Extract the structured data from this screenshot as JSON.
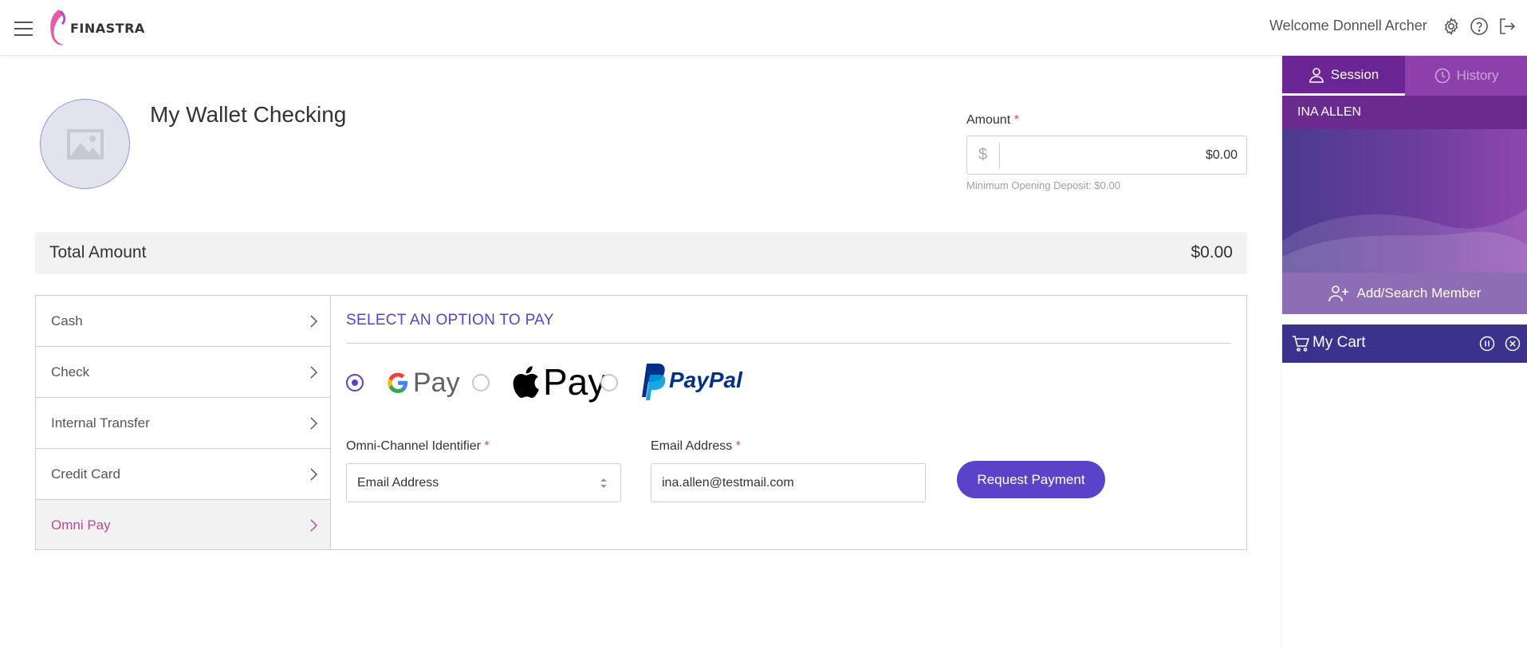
{
  "header": {
    "logo_text": "FINASTRA",
    "welcome": "Welcome Donnell Archer"
  },
  "product": {
    "title": "My Wallet Checking"
  },
  "amount": {
    "label": "Amount",
    "required_mark": "*",
    "currency_symbol": "$",
    "value": "$0.00",
    "min_deposit": "Minimum Opening Deposit: $0.00"
  },
  "total": {
    "label": "Total Amount",
    "value": "$0.00"
  },
  "payment_methods": [
    {
      "label": "Cash"
    },
    {
      "label": "Check"
    },
    {
      "label": "Internal Transfer"
    },
    {
      "label": "Credit Card"
    },
    {
      "label": "Omni Pay"
    }
  ],
  "active_method": "Omni Pay",
  "pay_option": {
    "title": "SELECT AN OPTION TO PAY",
    "options": [
      "G Pay",
      "Apple Pay",
      "PayPal"
    ],
    "selected": "G Pay",
    "gpay_text": "Pay",
    "applepay_text": "Pay",
    "paypal_text": "PayPal"
  },
  "form": {
    "identifier_label": "Omni-Channel Identifier",
    "identifier_value": "Email Address",
    "email_label": "Email Address",
    "email_value": "ina.allen@testmail.com",
    "required_mark": "*",
    "request_button": "Request Payment"
  },
  "sidebar": {
    "tab_session": "Session",
    "tab_history": "History",
    "member_name": "INA ALLEN",
    "add_member": "Add/Search Member",
    "cart_title": "My Cart"
  },
  "colors": {
    "accent": "#5a43c9",
    "active_method_text": "#c2459b",
    "sidebar_purple": "#6b2494",
    "cart_bar": "#3a338d"
  }
}
